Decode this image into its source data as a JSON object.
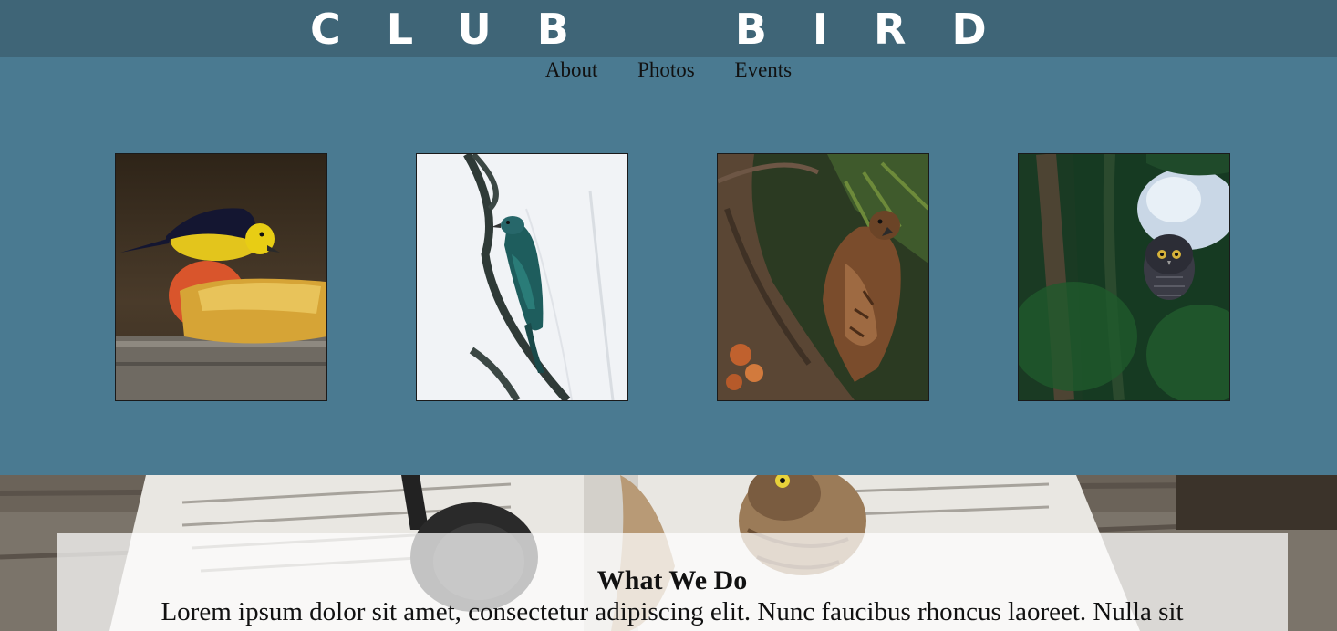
{
  "header": {
    "title": "CLUB  BIRD"
  },
  "nav": {
    "items": [
      {
        "label": "About"
      },
      {
        "label": "Photos"
      },
      {
        "label": "Events"
      }
    ]
  },
  "gallery": {
    "photos": [
      {
        "subject": "yellow-and-black songbird eating fruit"
      },
      {
        "subject": "teal cuckoo perched on branch"
      },
      {
        "subject": "hawk in tree"
      },
      {
        "subject": "owl in pine tree"
      }
    ]
  },
  "about": {
    "heading": "What We Do",
    "text": "Lorem ipsum dolor sit amet, consectetur adipiscing elit. Nunc faucibus rhoncus laoreet. Nulla sit"
  },
  "colors": {
    "header_bg": "#3f6577",
    "page_bg": "#4a7a91",
    "title_text": "#ffffff"
  }
}
